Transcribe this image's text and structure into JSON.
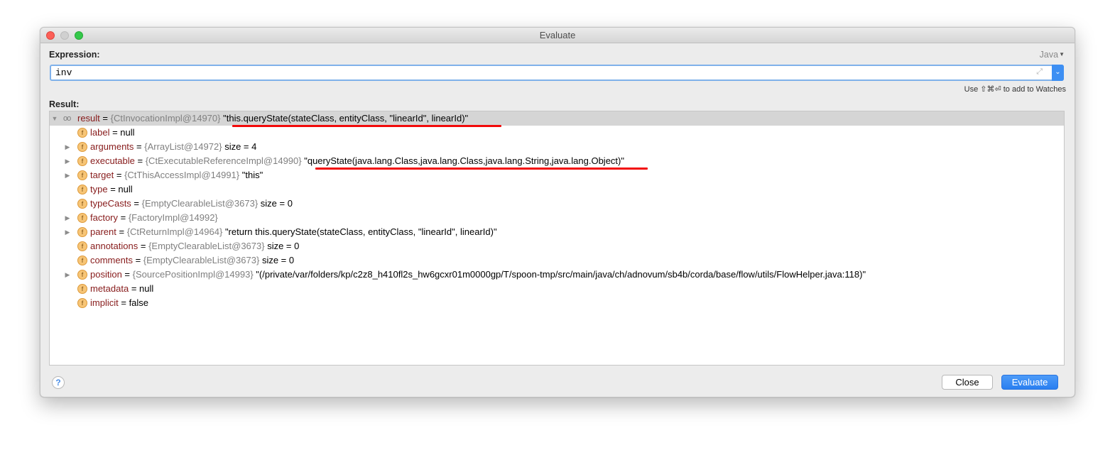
{
  "window": {
    "title": "Evaluate"
  },
  "expression": {
    "label": "Expression:",
    "language": "Java",
    "value": "inv",
    "hint": "Use ⇧⌘⏎ to add to Watches"
  },
  "result": {
    "label": "Result:",
    "rows": [
      {
        "name": "result",
        "ref": "{CtInvocationImpl@14970}",
        "value": "\"this.queryState(stateClass, entityClass, \"linearId\", linearId)\""
      },
      {
        "name": "label",
        "ref": "",
        "value": "null"
      },
      {
        "name": "arguments",
        "ref": "{ArrayList@14972}",
        "value": " size = 4"
      },
      {
        "name": "executable",
        "ref": "{CtExecutableReferenceImpl@14990}",
        "value": "\"queryState(java.lang.Class,java.lang.Class,java.lang.String,java.lang.Object)\""
      },
      {
        "name": "target",
        "ref": "{CtThisAccessImpl@14991}",
        "value": "\"this\""
      },
      {
        "name": "type",
        "ref": "",
        "value": "null"
      },
      {
        "name": "typeCasts",
        "ref": "{EmptyClearableList@3673}",
        "value": " size = 0"
      },
      {
        "name": "factory",
        "ref": "{FactoryImpl@14992}",
        "value": ""
      },
      {
        "name": "parent",
        "ref": "{CtReturnImpl@14964}",
        "value": "\"return this.queryState(stateClass, entityClass, \"linearId\", linearId)\""
      },
      {
        "name": "annotations",
        "ref": "{EmptyClearableList@3673}",
        "value": " size = 0"
      },
      {
        "name": "comments",
        "ref": "{EmptyClearableList@3673}",
        "value": " size = 0"
      },
      {
        "name": "position",
        "ref": "{SourcePositionImpl@14993}",
        "value": "\"(/private/var/folders/kp/c2z8_h410fl2s_hw6gcxr01m0000gp/T/spoon-tmp/src/main/java/ch/adnovum/sb4b/corda/base/flow/utils/FlowHelper.java:118)\""
      },
      {
        "name": "metadata",
        "ref": "",
        "value": "null"
      },
      {
        "name": "implicit",
        "ref": "",
        "value": "false"
      }
    ]
  },
  "field_badge": "f",
  "eq_sign": " = ",
  "help": "?",
  "buttons": {
    "close": "Close",
    "evaluate": "Evaluate"
  },
  "icons": {
    "expand": "expand-icon",
    "history": "chevron-down-icon",
    "watch": "glasses-icon",
    "field": "field-badge-icon"
  },
  "colors": {
    "accent": "#3d8ff3",
    "underline": "#f20a0a",
    "field_name": "#871b1b"
  }
}
